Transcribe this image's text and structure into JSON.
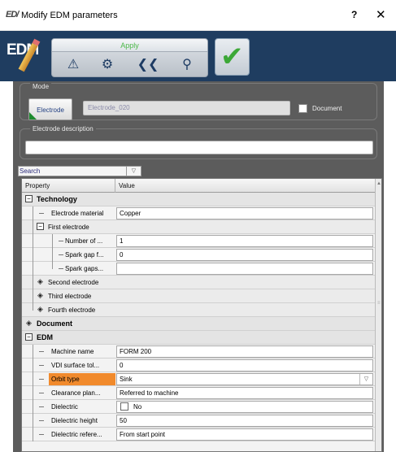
{
  "window": {
    "title": "Modify EDM parameters",
    "help": "?",
    "close": "✕",
    "app_icon": "ED/"
  },
  "toolbar": {
    "logo_text": "EDM",
    "apply_label": "Apply",
    "ok_icon": "✔",
    "tool_icons": [
      "⚠",
      "⚙",
      "❮❮",
      "⚲"
    ]
  },
  "mode": {
    "legend": "Mode",
    "electrode_button": "Electrode",
    "electrode_name": "Electrode_020",
    "document_label": "Document"
  },
  "description": {
    "legend": "Electrode description",
    "value": ""
  },
  "search": {
    "label": "Search",
    "arrow": "▽"
  },
  "grid": {
    "headers": {
      "property": "Property",
      "value": "Value"
    },
    "rows": [
      {
        "name": "Technology"
      },
      {
        "name": "Electrode material",
        "value": "Copper"
      },
      {
        "name": "First electrode"
      },
      {
        "name": "Number of ...",
        "value": "1"
      },
      {
        "name": "Spark gap f...",
        "value": "0"
      },
      {
        "name": "Spark gaps...",
        "value": ""
      },
      {
        "name": "Second electrode"
      },
      {
        "name": "Third electrode"
      },
      {
        "name": "Fourth electrode"
      },
      {
        "name": "Document"
      },
      {
        "name": "EDM"
      },
      {
        "name": "Machine name",
        "value": "FORM 200"
      },
      {
        "name": "VDI surface tol...",
        "value": "0"
      },
      {
        "name": "Orbit type",
        "value": "Sink"
      },
      {
        "name": "Clearance plan...",
        "value": "Referred to machine"
      },
      {
        "name": "Dielectric",
        "value": "No"
      },
      {
        "name": "Dielectric height",
        "value": "50"
      },
      {
        "name": "Dielectric refere...",
        "value": "From start point"
      }
    ],
    "expand_minus": "−",
    "diamond": "◈",
    "dropdown_arrow": "▽",
    "scroll_up": "▲",
    "scroll_grip": "≡"
  },
  "colors": {
    "toolbar_bg": "#1f3d60",
    "panel_bg": "#5c5c5c",
    "highlight": "#f18a2c",
    "apply_green": "#4bb848",
    "ok_green": "#3ca837"
  }
}
